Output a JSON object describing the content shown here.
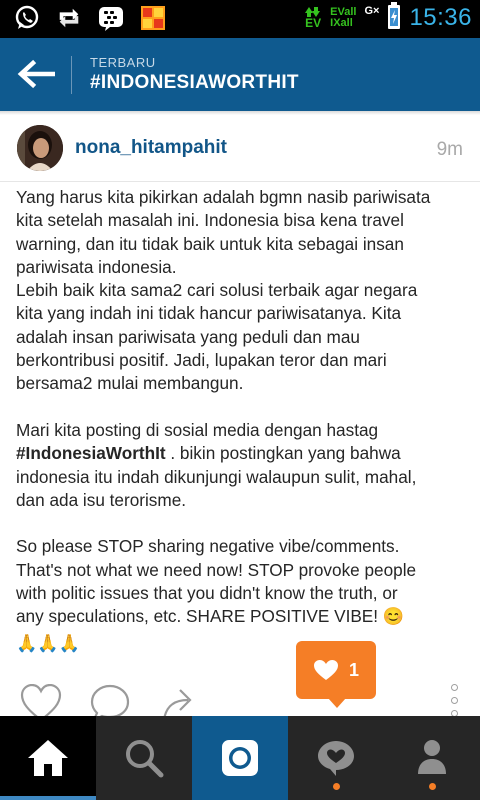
{
  "status_bar": {
    "time": "15:36",
    "signal_top": "EV",
    "signal_bottom": "EV",
    "signal_a": "EVall",
    "signal_b": "IXall",
    "signal_c": "G×",
    "notification_icons": [
      "whatsapp-icon",
      "retweet-icon",
      "bbm-icon",
      "photo-app-icon"
    ],
    "time_color": "#3ab4e8"
  },
  "header": {
    "subtitle": "TERBARU",
    "title": "#INDONESIAWORTHIT",
    "background": "#0f5a8f"
  },
  "post": {
    "username": "nona_hitampahit",
    "time_ago": "9m",
    "caption_lines": [
      "Yang harus kita pikirkan adalah bgmn nasib pariwisata",
      "kita setelah masalah ini. Indonesia bisa kena travel",
      "warning, dan itu tidak baik untuk kita sebagai insan",
      "pariwisata indonesia.",
      "Lebih baik kita sama2 cari solusi terbaik agar negara",
      "kita yang indah ini tidak hancur pariwisatanya. Kita",
      "adalah insan pariwisata yang peduli dan mau",
      "berkontribusi positif. Jadi, lupakan teror dan mari",
      "bersama2 mulai membangun.",
      "",
      "Mari kita posting di sosial media dengan hastag",
      "",
      "indonesia itu indah dikunjungi walaupun sulit, mahal,",
      "dan ada isu terorisme.",
      "",
      "So please STOP sharing negative vibe/comments.",
      "That's not what we need now! STOP provoke people",
      "with politic issues that you didn't know the truth, or",
      "any speculations, etc. SHARE POSITIVE VIBE! 😊",
      "🙏🙏🙏"
    ],
    "hashtag": "#IndonesiaWorthIt",
    "hashtag_rest": " . bikin postingkan yang bahwa"
  },
  "likes": {
    "count": "1",
    "color": "#f57e26"
  },
  "actions": [
    "heart-icon",
    "comment-icon",
    "share-icon",
    "more-icon"
  ],
  "bottom_nav": [
    "home-icon",
    "search-icon",
    "camera-icon",
    "activity-icon",
    "profile-icon"
  ]
}
